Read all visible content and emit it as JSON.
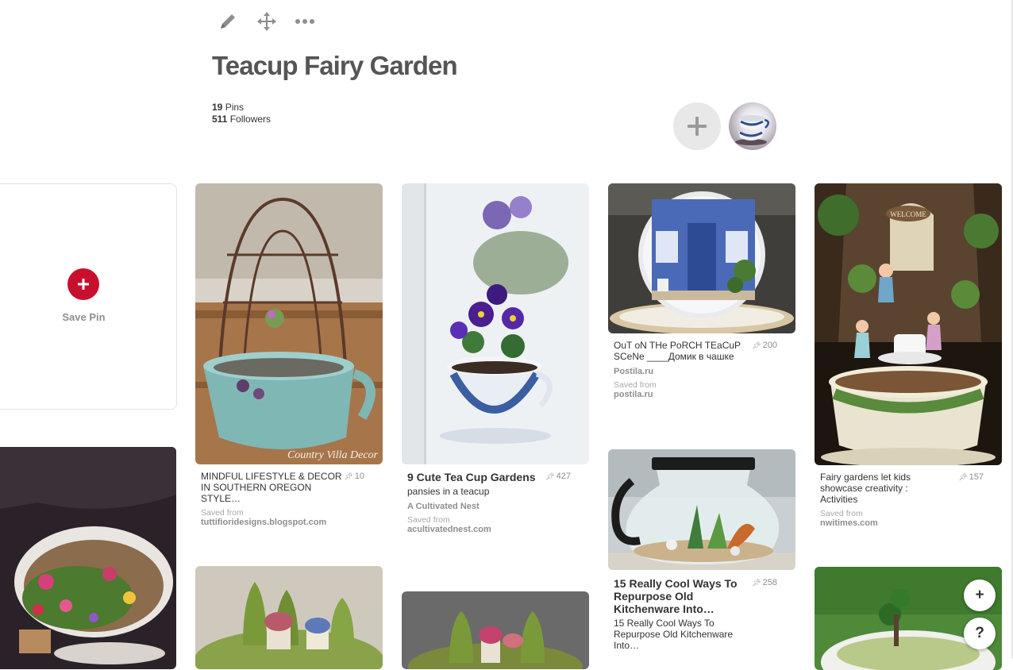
{
  "toolbar": {
    "edit_icon": "pencil-icon",
    "move_icon": "move-arrows-icon",
    "more_icon": "more-dots-icon"
  },
  "board": {
    "title": "Teacup Fairy Garden",
    "pins_count": "19",
    "pins_label": "Pins",
    "followers_count": "511",
    "followers_label": "Followers",
    "add_collaborator_icon": "plus-icon",
    "owner_avatar": "teacup-avatar"
  },
  "save_card": {
    "label": "Save Pin",
    "icon": "plus-icon",
    "color": "#c8102e"
  },
  "pins": {
    "p1": {
      "title": "MINDFUL LIFESTYLE & DECOR IN SOUTHERN OREGON STYLE…",
      "saves": "10",
      "saved_from_label": "Saved from",
      "domain": "tuttifioridesigns.blogspot.com",
      "watermark": "Country Villa Decor"
    },
    "p2": {
      "title": "9 Cute Tea Cup Gardens",
      "saves": "427",
      "description": "pansies in a teacup",
      "source": "A Cultivated Nest",
      "saved_from_label": "Saved from",
      "domain": "acultivatednest.com"
    },
    "p3": {
      "title": "OuT oN THe PoRCH TEaCuP SCeNe ____Домик в чашке",
      "saves": "200",
      "source": "Postila.ru",
      "saved_from_label": "Saved from",
      "domain": "postila.ru"
    },
    "p4": {
      "title": "Fairy gardens let kids showcase creativity : Activities",
      "saves": "157",
      "saved_from_label": "Saved from",
      "domain": "nwitimes.com",
      "sign_text": "WELCOME"
    },
    "p5": {
      "title": "15 Really Cool Ways To Repurpose Old Kitchenware Into…",
      "saves": "258",
      "description": "15 Really Cool Ways To Repurpose Old Kitchenware Into…"
    }
  },
  "fab": {
    "add_label": "+",
    "help_label": "?"
  },
  "colors": {
    "brand_red": "#c8102e",
    "muted_text": "#8e8e8e",
    "title_text": "#555555"
  }
}
